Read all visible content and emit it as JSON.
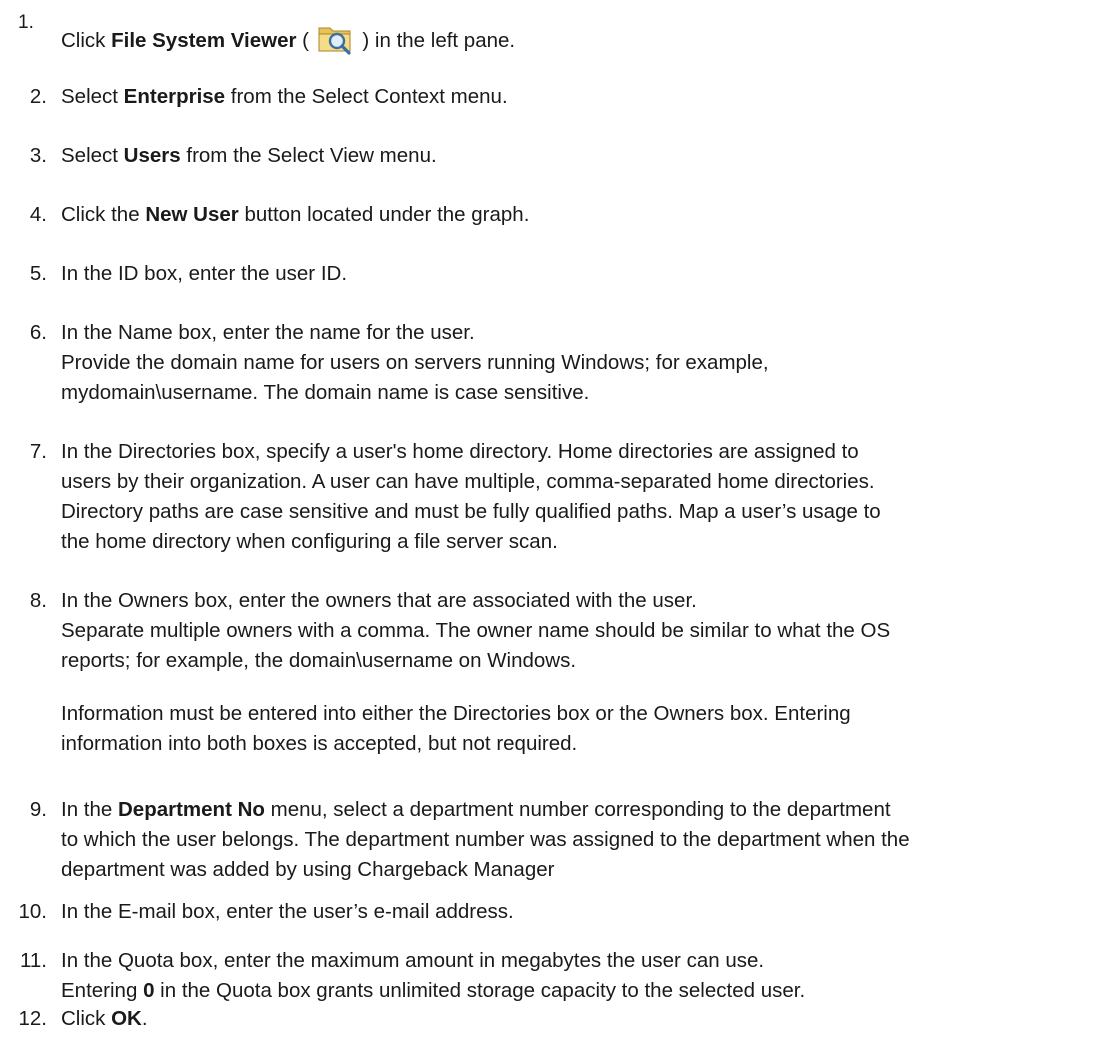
{
  "steps": [
    {
      "num": "1.",
      "pre": "Click ",
      "bold": "File System Viewer",
      "post_open": " ( ",
      "icon": "folder-magnifier-icon",
      "post_close": " ) in the left pane."
    },
    {
      "num": "2.",
      "pre": "Select ",
      "bold": "Enterprise",
      "post": " from the Select Context menu."
    },
    {
      "num": "3.",
      "pre": "Select ",
      "bold": "Users",
      "post": " from the Select View menu."
    },
    {
      "num": "4.",
      "pre": "Click the ",
      "bold": "New User",
      "post": " button located under the graph."
    },
    {
      "num": "5.",
      "text": "In the ID box, enter the user ID."
    },
    {
      "num": "6.",
      "line1": "In the Name box, enter the name for the user.",
      "line2": "Provide the domain name for users on servers running Windows; for example,",
      "line3": "mydomain\\username. The domain name is case sensitive."
    },
    {
      "num": "7.",
      "line1": "In the Directories box, specify a user's home directory. Home directories are assigned to",
      "line2": "users by their organization. A user can have multiple, comma-separated home directories.",
      "line3": "Directory paths are case sensitive and must be fully qualified paths. Map a user’s usage to",
      "line4": "the home directory when configuring a file server scan."
    },
    {
      "num": "8.",
      "line1": "In the Owners box, enter the owners that are associated with the user.",
      "line2": "Separate multiple owners with a comma. The owner name should be similar to what the OS",
      "line3": "reports; for example, the domain\\username on Windows.",
      "note1": "Information must be entered into either the Directories box or the Owners box. Entering",
      "note2": "information into both boxes is accepted, but not required."
    },
    {
      "num": "9.",
      "pre": "In the ",
      "bold": "Department No",
      "post": " menu, select a department number corresponding to the department",
      "line2": "to which the user belongs. The department number was assigned to the department when the",
      "line3": "department was added by using Chargeback Manager"
    },
    {
      "num": "10.",
      "text": "In the E-mail box, enter the user’s e-mail address."
    },
    {
      "num": "11.",
      "line1": "In the Quota box, enter the maximum amount in megabytes the user can use.",
      "pre2": "Entering ",
      "bold2": "0",
      "post2": " in the Quota box grants unlimited storage capacity to the selected user."
    },
    {
      "num": "12.",
      "pre": "Click ",
      "bold": "OK",
      "post": "."
    }
  ]
}
